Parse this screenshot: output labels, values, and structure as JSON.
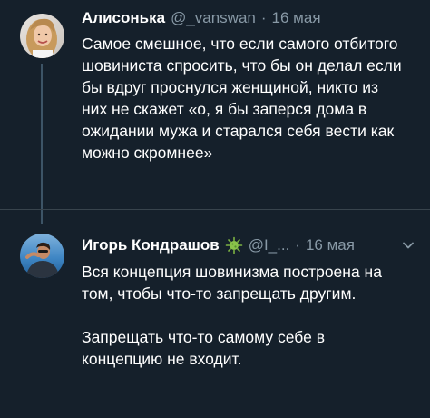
{
  "tweets": [
    {
      "author_name": "Алисонька",
      "handle": "@_vanswan",
      "separator": "·",
      "date": "16 мая",
      "text": "Самое смешное, что если самого отбитого\nшовиниста спросить, что бы он делал если\nбы вдруг проснулся женщиной, никто из\nних не скажет «о, я бы заперся дома в\nожидании мужа и старался себя вести как\nможно скромнее»"
    },
    {
      "author_name": "Игорь Кондрашов",
      "handle": "@I_...",
      "separator": "·",
      "date": "16 мая",
      "text": "Вся концепция шовинизма построена на\nтом, чтобы что-то запрещать другим.\n\nЗапрещать что-то самому себе в\nконцепцию не входит."
    }
  ],
  "colors": {
    "background": "#15202b",
    "text_primary": "#ffffff",
    "text_secondary": "#8899a6",
    "divider": "#38444d",
    "thread_line": "#3d5466"
  },
  "icons": {
    "badge": "virus-emoji-icon",
    "menu": "chevron-down-icon"
  }
}
